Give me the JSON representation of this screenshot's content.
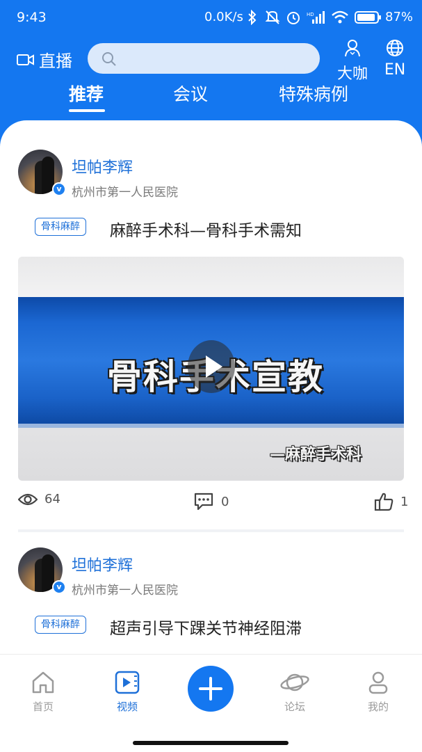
{
  "status_bar": {
    "time": "9:43",
    "network_speed": "0.0K/s",
    "battery": "87%"
  },
  "top_bar": {
    "live_label": "直播",
    "search_placeholder": "",
    "expert_label": "大咖",
    "language_label": "EN"
  },
  "tabs": [
    {
      "label": "推荐",
      "active": true
    },
    {
      "label": "会议",
      "active": false
    },
    {
      "label": "特殊病例",
      "active": false
    }
  ],
  "posts": [
    {
      "author": "坦帕李辉",
      "hospital": "杭州市第一人民医院",
      "tag": "骨科麻醉",
      "title": "麻醉手术科—骨科手术需知",
      "video": {
        "main_text": "骨科手术宣教",
        "sub_text": "—麻醉手术科"
      },
      "views": "64",
      "comments": "0",
      "likes": "1"
    },
    {
      "author": "坦帕李辉",
      "hospital": "杭州市第一人民医院",
      "tag": "骨科麻醉",
      "title": "超声引导下踝关节神经阻滞"
    }
  ],
  "bottom_nav": [
    {
      "label": "首页",
      "icon": "home-icon",
      "active": false
    },
    {
      "label": "视频",
      "icon": "video-icon",
      "active": true
    },
    {
      "label": "",
      "icon": "plus-icon",
      "active": false
    },
    {
      "label": "论坛",
      "icon": "planet-icon",
      "active": false
    },
    {
      "label": "我的",
      "icon": "person-icon",
      "active": false
    }
  ],
  "colors": {
    "brand_blue": "#1477f0",
    "link_blue": "#1e70d8"
  }
}
